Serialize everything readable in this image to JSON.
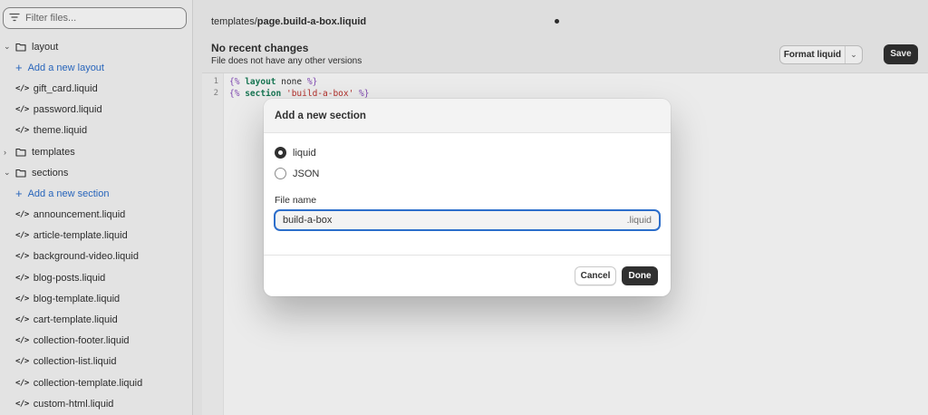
{
  "sidebar": {
    "filter_placeholder": "Filter files...",
    "tree": [
      {
        "type": "folder",
        "expanded": true,
        "label": "layout"
      },
      {
        "type": "add",
        "label": "Add a new layout"
      },
      {
        "type": "file",
        "label": "gift_card.liquid"
      },
      {
        "type": "file",
        "label": "password.liquid"
      },
      {
        "type": "file",
        "label": "theme.liquid"
      },
      {
        "type": "folder",
        "expanded": false,
        "label": "templates"
      },
      {
        "type": "folder",
        "expanded": true,
        "label": "sections"
      },
      {
        "type": "add",
        "label": "Add a new section"
      },
      {
        "type": "file",
        "label": "announcement.liquid"
      },
      {
        "type": "file",
        "label": "article-template.liquid"
      },
      {
        "type": "file",
        "label": "background-video.liquid"
      },
      {
        "type": "file",
        "label": "blog-posts.liquid"
      },
      {
        "type": "file",
        "label": "blog-template.liquid"
      },
      {
        "type": "file",
        "label": "cart-template.liquid"
      },
      {
        "type": "file",
        "label": "collection-footer.liquid"
      },
      {
        "type": "file",
        "label": "collection-list.liquid"
      },
      {
        "type": "file",
        "label": "collection-template.liquid"
      },
      {
        "type": "file",
        "label": "custom-html.liquid"
      }
    ]
  },
  "tab": {
    "path_prefix": "templates/",
    "path_file": "page.build-a-box.liquid"
  },
  "toolbar": {
    "title": "No recent changes",
    "subtitle": "File does not have any other versions",
    "format_label": "Format liquid",
    "save_label": "Save"
  },
  "code": {
    "lines": [
      {
        "num": "1",
        "open": "{%",
        "kw": "layout",
        "arg": " none ",
        "close": "%}"
      },
      {
        "num": "2",
        "open": "{%",
        "kw": "section",
        "arg": " ",
        "str": "'build-a-box'",
        "close": " %}"
      }
    ]
  },
  "dialog": {
    "title": "Add a new section",
    "options": [
      {
        "label": "liquid",
        "selected": true
      },
      {
        "label": "JSON",
        "selected": false
      }
    ],
    "file_name_label": "File name",
    "file_name_value": "build-a-box",
    "file_suffix": ".liquid",
    "cancel_label": "Cancel",
    "done_label": "Done"
  },
  "colors": {
    "accent": "#2c6ecb",
    "primary_button": "#303030"
  }
}
